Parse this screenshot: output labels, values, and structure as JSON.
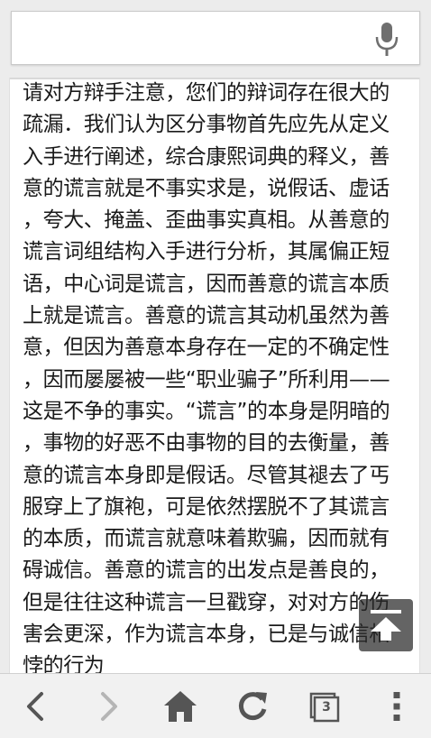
{
  "search": {
    "value": "",
    "placeholder": ""
  },
  "toolbar": {
    "mic_icon": "microphone-icon"
  },
  "article": {
    "lines": [
      "请对方辩手注意，您们的辩词存在很大的",
      "疏漏．我们认为区分事物首先应先从定义",
      "入手进行阐述，综合康熙词典的释义，善",
      "意的谎言就是不事实求是，说假话、虚话",
      "，夸大、掩盖、歪曲事实真相。从善意的",
      "谎言词组结构入手进行分析，其属偏正短",
      "语，中心词是谎言，因而善意的谎言本质",
      "上就是谎言。善意的谎言其动机虽然为善",
      "意，但因为善意本身存在一定的不确定性",
      "，因而屡屡被一些“职业骗子”所利用——",
      "这是不争的事实。“谎言”的本身是阴暗的",
      "，事物的好恶不由事物的目的去衡量，善",
      "意的谎言本身即是假话。尽管其褪去了丐",
      "服穿上了旗袍，可是依然摆脱不了其谎言",
      "的本质，而谎言就意味着欺骗，因而就有",
      "碍诚信。善意的谎言的出发点是善良的，",
      "但是往往这种谎言一旦戳穿，对对方的伤",
      "害会更深，作为谎言本身，已是与诚信相",
      "悖的行为"
    ]
  },
  "controls": {
    "back_to_top_icon": "back-to-top-icon"
  },
  "bottom_nav": {
    "back_icon": "back-arrow-icon",
    "forward_icon": "forward-arrow-icon",
    "home_icon": "home-icon",
    "refresh_icon": "refresh-icon",
    "tabs_count": "3",
    "menu_icon": "overflow-menu-icon"
  },
  "colors": {
    "background": "#ececec",
    "text": "#1a1a1a",
    "icon": "#555555",
    "icon_disabled": "#b5b5b5"
  }
}
